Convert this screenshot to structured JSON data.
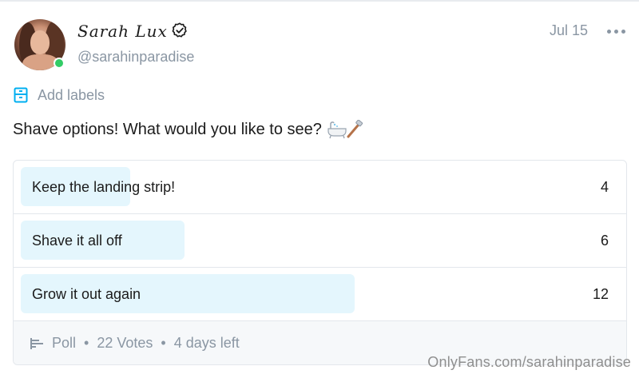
{
  "post": {
    "author_name": "Sarah Lux",
    "author_handle": "@sarahinparadise",
    "date": "Jul 15",
    "add_labels": "Add labels",
    "text": "Shave options! What would you like to see?",
    "emoji_icon": "bathtub-and-razor-icon"
  },
  "poll": {
    "options": [
      {
        "label": "Keep the landing strip!",
        "votes": "4",
        "share": 0.18
      },
      {
        "label": "Shave it all off",
        "votes": "6",
        "share": 0.27
      },
      {
        "label": "Grow it out again",
        "votes": "12",
        "share": 0.55
      }
    ],
    "footer": {
      "type": "Poll",
      "votes": "22 Votes",
      "time_left": "4 days left"
    }
  },
  "watermark": "OnlyFans.com/sarahinparadise",
  "colors": {
    "accent": "#00aff0",
    "muted": "#8a96a3",
    "poll_fill": "#e4f6fd",
    "online": "#33cc66"
  }
}
